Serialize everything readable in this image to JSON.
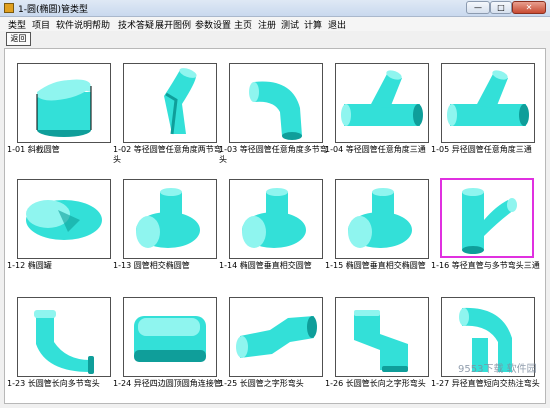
{
  "window": {
    "title": "1-圆(椭圆)管类型",
    "minimize": "—",
    "maximize": "□",
    "close": "✕"
  },
  "menu": [
    "类型",
    "项目",
    "软件说明",
    "帮助",
    "技术答疑",
    "展开图例",
    "参数设置",
    "主页",
    "注册",
    "测试",
    "计算",
    "退出"
  ],
  "toolbar": {
    "back_label": "返回"
  },
  "grid": [
    {
      "caption": "1-01  斜截圆管",
      "shape": "cylinder",
      "selected": false
    },
    {
      "caption": "1-02  等径圆管任意角度两节弯头",
      "shape": "elbow2",
      "selected": false
    },
    {
      "caption": "1-03  等径圆管任意角度多节弯头",
      "shape": "elbow3",
      "selected": false
    },
    {
      "caption": "1-04  等径圆管任意角度三通",
      "shape": "tee",
      "selected": false
    },
    {
      "caption": "1-05  异径圆管任意角度三通",
      "shape": "tee",
      "selected": false
    },
    {
      "caption": "1-12  椭圆罐",
      "shape": "tank",
      "selected": false
    },
    {
      "caption": "1-13  圆管相交椭圆管",
      "shape": "ovaltee",
      "selected": false
    },
    {
      "caption": "1-14  椭圆管垂直相交圆管",
      "shape": "ovaltee",
      "selected": false
    },
    {
      "caption": "1-15  椭圆管垂直相交椭圆管",
      "shape": "ovaltee",
      "selected": false
    },
    {
      "caption": "1-16  等径直管与多节弯头三通",
      "shape": "elbowtee",
      "selected": true
    },
    {
      "caption": "1-23  长圆管长向多节弯头",
      "shape": "rect_elbow",
      "selected": false
    },
    {
      "caption": "1-24  异径四边圆顶圆角连接管",
      "shape": "rect_box",
      "selected": false
    },
    {
      "caption": "1-25  长圆管之字形弯头",
      "shape": "zig",
      "selected": false
    },
    {
      "caption": "1-26  长圆管长向之字形弯头",
      "shape": "zig2",
      "selected": false
    },
    {
      "caption": "1-27  异径直管短向交热注弯头",
      "shape": "twin",
      "selected": false
    }
  ],
  "watermark": "9553下载 软件园",
  "colors": {
    "pipe": "#33e0d8",
    "pipe_dark": "#0f9e9a",
    "selection": "#e030e0"
  }
}
